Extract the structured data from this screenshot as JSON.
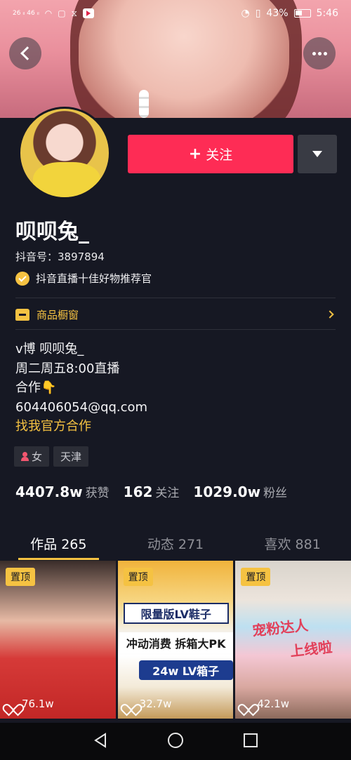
{
  "status_bar": {
    "signal_left": "26 ᵢₗ 46 ᵢₗ",
    "battery_percent": "43%",
    "time": "5:46"
  },
  "profile": {
    "nickname": "呗呗兔_",
    "douyin_id": "抖音号：3897894",
    "verification": "抖音直播十佳好物推荐官",
    "follow_label": "关注",
    "follow_plus": "+"
  },
  "shop": {
    "label": "商品橱窗"
  },
  "bio": {
    "lines": [
      "v博 呗呗兔_",
      "周二周五8:00直播",
      "合作👇",
      "604406054@qq.com"
    ],
    "link": "找我官方合作"
  },
  "tags": {
    "gender": "女",
    "location": "天津"
  },
  "stats": {
    "likes_num": "4407.8w",
    "likes_label": "获赞",
    "following_num": "162",
    "following_label": "关注",
    "followers_num": "1029.0w",
    "followers_label": "粉丝"
  },
  "tabs": [
    {
      "label": "作品 265",
      "active": true
    },
    {
      "label": "动态 271",
      "active": false
    },
    {
      "label": "喜欢 881",
      "active": false
    }
  ],
  "videos": [
    {
      "pin": "置顶",
      "likes": "76.1w"
    },
    {
      "pin": "置顶",
      "likes": "32.7w",
      "caption1": "限量版LV鞋子",
      "caption2": "冲动消费 拆箱大PK",
      "caption3": "24w LV箱子"
    },
    {
      "pin": "置顶",
      "likes": "42.1w",
      "caption1": "宠粉达人",
      "caption2": "上线啦"
    }
  ],
  "colors": {
    "accent_red": "#fe2c55",
    "accent_yellow": "#f5c242",
    "background": "#161823"
  },
  "icons": {
    "back": "chevron-left-icon",
    "more": "more-dots-icon",
    "dropdown": "caret-down-icon",
    "verify": "check-badge-icon",
    "shop": "shop-icon",
    "gender": "female-icon",
    "like": "heart-icon"
  }
}
